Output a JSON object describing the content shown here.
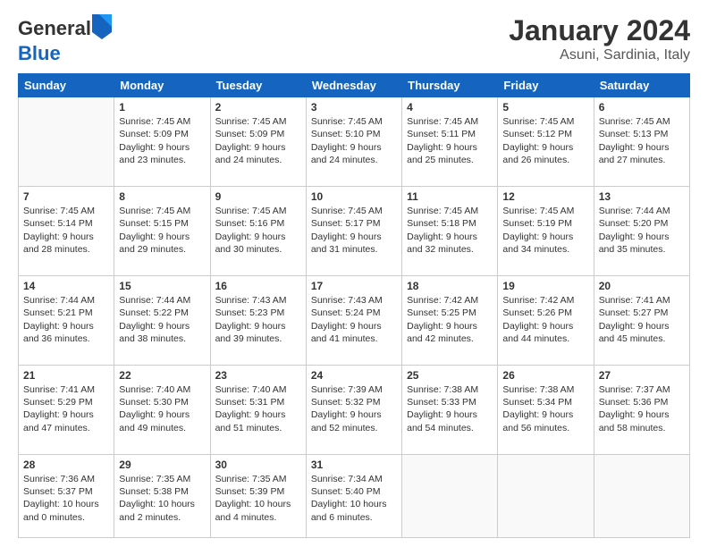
{
  "header": {
    "logo_line1": "General",
    "logo_line2": "Blue",
    "month": "January 2024",
    "location": "Asuni, Sardinia, Italy"
  },
  "weekdays": [
    "Sunday",
    "Monday",
    "Tuesday",
    "Wednesday",
    "Thursday",
    "Friday",
    "Saturday"
  ],
  "rows": [
    [
      {
        "day": "",
        "lines": []
      },
      {
        "day": "1",
        "lines": [
          "Sunrise: 7:45 AM",
          "Sunset: 5:09 PM",
          "Daylight: 9 hours",
          "and 23 minutes."
        ]
      },
      {
        "day": "2",
        "lines": [
          "Sunrise: 7:45 AM",
          "Sunset: 5:09 PM",
          "Daylight: 9 hours",
          "and 24 minutes."
        ]
      },
      {
        "day": "3",
        "lines": [
          "Sunrise: 7:45 AM",
          "Sunset: 5:10 PM",
          "Daylight: 9 hours",
          "and 24 minutes."
        ]
      },
      {
        "day": "4",
        "lines": [
          "Sunrise: 7:45 AM",
          "Sunset: 5:11 PM",
          "Daylight: 9 hours",
          "and 25 minutes."
        ]
      },
      {
        "day": "5",
        "lines": [
          "Sunrise: 7:45 AM",
          "Sunset: 5:12 PM",
          "Daylight: 9 hours",
          "and 26 minutes."
        ]
      },
      {
        "day": "6",
        "lines": [
          "Sunrise: 7:45 AM",
          "Sunset: 5:13 PM",
          "Daylight: 9 hours",
          "and 27 minutes."
        ]
      }
    ],
    [
      {
        "day": "7",
        "lines": [
          "Sunrise: 7:45 AM",
          "Sunset: 5:14 PM",
          "Daylight: 9 hours",
          "and 28 minutes."
        ]
      },
      {
        "day": "8",
        "lines": [
          "Sunrise: 7:45 AM",
          "Sunset: 5:15 PM",
          "Daylight: 9 hours",
          "and 29 minutes."
        ]
      },
      {
        "day": "9",
        "lines": [
          "Sunrise: 7:45 AM",
          "Sunset: 5:16 PM",
          "Daylight: 9 hours",
          "and 30 minutes."
        ]
      },
      {
        "day": "10",
        "lines": [
          "Sunrise: 7:45 AM",
          "Sunset: 5:17 PM",
          "Daylight: 9 hours",
          "and 31 minutes."
        ]
      },
      {
        "day": "11",
        "lines": [
          "Sunrise: 7:45 AM",
          "Sunset: 5:18 PM",
          "Daylight: 9 hours",
          "and 32 minutes."
        ]
      },
      {
        "day": "12",
        "lines": [
          "Sunrise: 7:45 AM",
          "Sunset: 5:19 PM",
          "Daylight: 9 hours",
          "and 34 minutes."
        ]
      },
      {
        "day": "13",
        "lines": [
          "Sunrise: 7:44 AM",
          "Sunset: 5:20 PM",
          "Daylight: 9 hours",
          "and 35 minutes."
        ]
      }
    ],
    [
      {
        "day": "14",
        "lines": [
          "Sunrise: 7:44 AM",
          "Sunset: 5:21 PM",
          "Daylight: 9 hours",
          "and 36 minutes."
        ]
      },
      {
        "day": "15",
        "lines": [
          "Sunrise: 7:44 AM",
          "Sunset: 5:22 PM",
          "Daylight: 9 hours",
          "and 38 minutes."
        ]
      },
      {
        "day": "16",
        "lines": [
          "Sunrise: 7:43 AM",
          "Sunset: 5:23 PM",
          "Daylight: 9 hours",
          "and 39 minutes."
        ]
      },
      {
        "day": "17",
        "lines": [
          "Sunrise: 7:43 AM",
          "Sunset: 5:24 PM",
          "Daylight: 9 hours",
          "and 41 minutes."
        ]
      },
      {
        "day": "18",
        "lines": [
          "Sunrise: 7:42 AM",
          "Sunset: 5:25 PM",
          "Daylight: 9 hours",
          "and 42 minutes."
        ]
      },
      {
        "day": "19",
        "lines": [
          "Sunrise: 7:42 AM",
          "Sunset: 5:26 PM",
          "Daylight: 9 hours",
          "and 44 minutes."
        ]
      },
      {
        "day": "20",
        "lines": [
          "Sunrise: 7:41 AM",
          "Sunset: 5:27 PM",
          "Daylight: 9 hours",
          "and 45 minutes."
        ]
      }
    ],
    [
      {
        "day": "21",
        "lines": [
          "Sunrise: 7:41 AM",
          "Sunset: 5:29 PM",
          "Daylight: 9 hours",
          "and 47 minutes."
        ]
      },
      {
        "day": "22",
        "lines": [
          "Sunrise: 7:40 AM",
          "Sunset: 5:30 PM",
          "Daylight: 9 hours",
          "and 49 minutes."
        ]
      },
      {
        "day": "23",
        "lines": [
          "Sunrise: 7:40 AM",
          "Sunset: 5:31 PM",
          "Daylight: 9 hours",
          "and 51 minutes."
        ]
      },
      {
        "day": "24",
        "lines": [
          "Sunrise: 7:39 AM",
          "Sunset: 5:32 PM",
          "Daylight: 9 hours",
          "and 52 minutes."
        ]
      },
      {
        "day": "25",
        "lines": [
          "Sunrise: 7:38 AM",
          "Sunset: 5:33 PM",
          "Daylight: 9 hours",
          "and 54 minutes."
        ]
      },
      {
        "day": "26",
        "lines": [
          "Sunrise: 7:38 AM",
          "Sunset: 5:34 PM",
          "Daylight: 9 hours",
          "and 56 minutes."
        ]
      },
      {
        "day": "27",
        "lines": [
          "Sunrise: 7:37 AM",
          "Sunset: 5:36 PM",
          "Daylight: 9 hours",
          "and 58 minutes."
        ]
      }
    ],
    [
      {
        "day": "28",
        "lines": [
          "Sunrise: 7:36 AM",
          "Sunset: 5:37 PM",
          "Daylight: 10 hours",
          "and 0 minutes."
        ]
      },
      {
        "day": "29",
        "lines": [
          "Sunrise: 7:35 AM",
          "Sunset: 5:38 PM",
          "Daylight: 10 hours",
          "and 2 minutes."
        ]
      },
      {
        "day": "30",
        "lines": [
          "Sunrise: 7:35 AM",
          "Sunset: 5:39 PM",
          "Daylight: 10 hours",
          "and 4 minutes."
        ]
      },
      {
        "day": "31",
        "lines": [
          "Sunrise: 7:34 AM",
          "Sunset: 5:40 PM",
          "Daylight: 10 hours",
          "and 6 minutes."
        ]
      },
      {
        "day": "",
        "lines": []
      },
      {
        "day": "",
        "lines": []
      },
      {
        "day": "",
        "lines": []
      }
    ]
  ]
}
